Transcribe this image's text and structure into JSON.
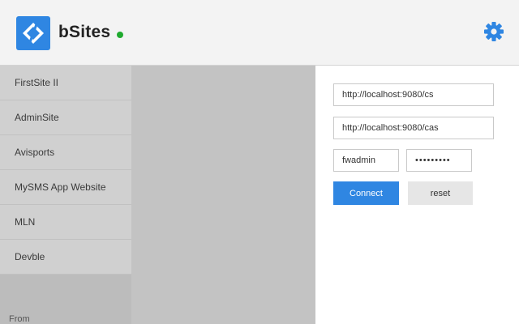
{
  "app": {
    "title": "bSites",
    "status_color": "#1faa2f",
    "accent_color": "#2f86e2",
    "logo_icon": "bsites-logo-icon",
    "settings_icon": "gear-icon"
  },
  "sidebar": {
    "items": [
      {
        "label": "FirstSite II"
      },
      {
        "label": "AdminSite"
      },
      {
        "label": "Avisports"
      },
      {
        "label": "MySMS App Website"
      },
      {
        "label": "MLN"
      },
      {
        "label": "Devble"
      }
    ],
    "footer_label": "From"
  },
  "form": {
    "cs_url": "http://localhost:9080/cs",
    "cas_url": "http://localhost:9080/cas",
    "username": "fwadmin",
    "password": "xxxxxxxxx",
    "connect_label": "Connect",
    "reset_label": "reset"
  }
}
